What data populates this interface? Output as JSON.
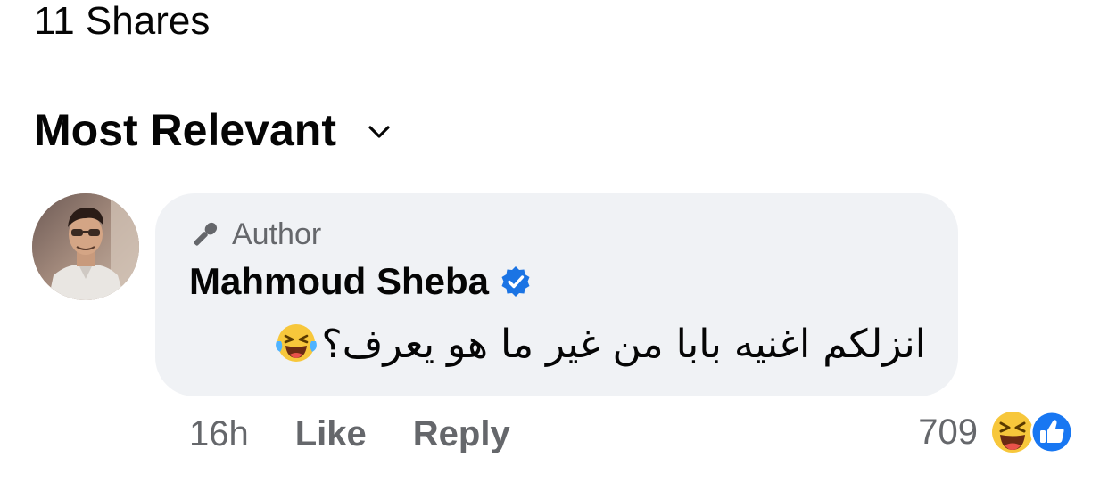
{
  "shares": {
    "label": "11 Shares"
  },
  "sort": {
    "label": "Most Relevant"
  },
  "comment": {
    "badge": "Author",
    "author": "Mahmoud Sheba",
    "text": "انزلكم اغنيه بابا من غير ما هو يعرف؟",
    "emoji": "laughing-tears",
    "time": "16h",
    "like_label": "Like",
    "reply_label": "Reply",
    "reaction_count": "709",
    "reactions": [
      "haha",
      "like"
    ]
  },
  "colors": {
    "bubble": "#f0f2f5",
    "secondary_text": "#65676b",
    "verified": "#1b74e4",
    "like_blue": "#1877f2"
  }
}
